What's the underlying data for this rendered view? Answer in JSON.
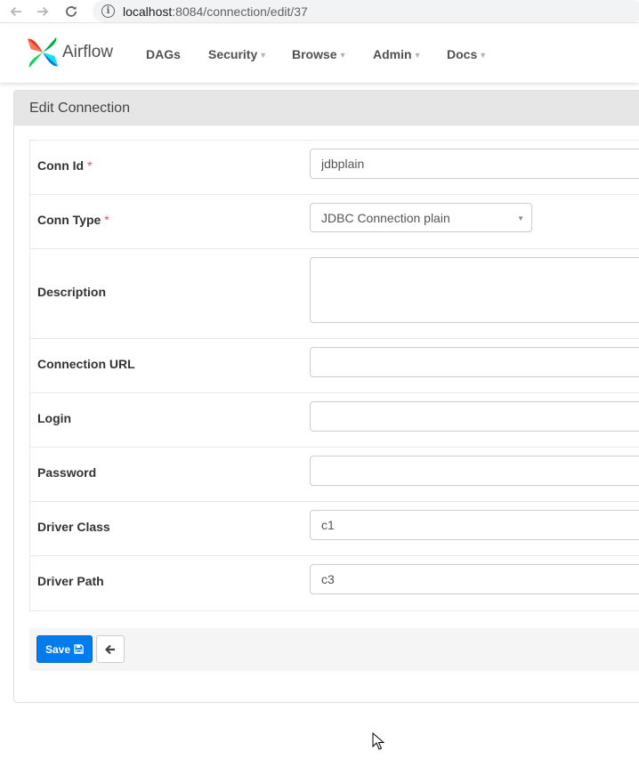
{
  "browser": {
    "url_host": "localhost",
    "url_path": ":8084/connection/edit/37"
  },
  "navbar": {
    "brand": "Airflow",
    "menu": [
      {
        "label": "DAGs"
      },
      {
        "label": "Security"
      },
      {
        "label": "Browse"
      },
      {
        "label": "Admin"
      },
      {
        "label": "Docs"
      }
    ]
  },
  "panel": {
    "title": "Edit Connection"
  },
  "form": {
    "conn_id": {
      "label": "Conn Id",
      "required_mark": "*",
      "value": "jdbplain"
    },
    "conn_type": {
      "label": "Conn Type",
      "required_mark": "*",
      "value": "JDBC Connection plain"
    },
    "description": {
      "label": "Description",
      "value": ""
    },
    "connection_url": {
      "label": "Connection URL",
      "value": ""
    },
    "login": {
      "label": "Login",
      "value": ""
    },
    "password": {
      "label": "Password",
      "value": ""
    },
    "driver_class": {
      "label": "Driver Class",
      "value": "c1"
    },
    "driver_path": {
      "label": "Driver Path",
      "value": "c3"
    }
  },
  "actions": {
    "save_label": "Save"
  },
  "colors": {
    "primary": "#017cee",
    "required": "#d9534f",
    "panel_heading": "#e6e6e6"
  },
  "icons": {
    "back": "arrow-left-icon",
    "forward": "arrow-right-icon",
    "reload": "reload-icon",
    "site_info": "info-icon",
    "save": "floppy-disk-icon",
    "return": "arrow-left-icon",
    "logo": "airflow-pinwheel-logo",
    "pointer": "mouse-cursor-icon"
  }
}
